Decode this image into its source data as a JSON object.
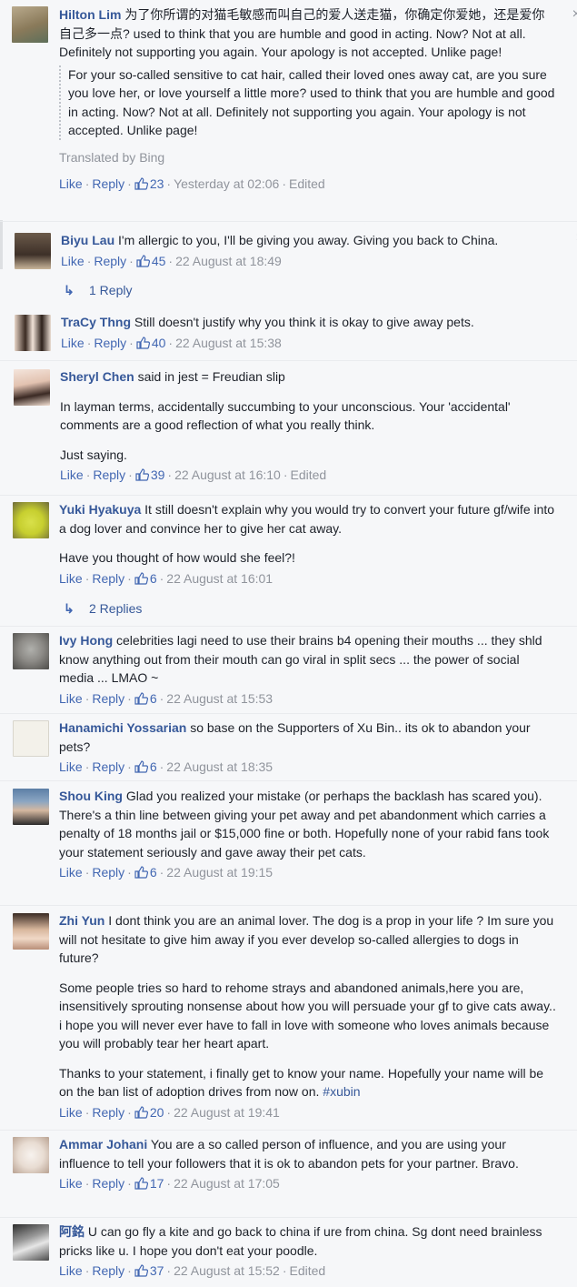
{
  "comments": [
    {
      "author": "Hilton Lim",
      "text": "为了你所谓的对猫毛敏感而叫自己的爱人送走猫，你确定你爱她，还是爱你自己多一点? used to think that you are humble and good in acting. Now? Not at all. Definitely not supporting you again. Your apology is not accepted. Unlike page!",
      "translation": "For your so-called sensitive to cat hair, called their loved ones away cat, are you sure you love her, or love yourself a little more? used to think that you are humble and good in acting. Now? Not at all. Definitely not supporting you again. Your apology is not accepted. Unlike page!",
      "translated_by": "Translated by Bing",
      "like": "Like",
      "reply": "Reply",
      "likes": "23",
      "time": "Yesterday at 02:06",
      "edited": "Edited"
    },
    {
      "author": "Biyu Lau",
      "text": "I'm allergic to you, I'll be giving you away. Giving you back to China.",
      "like": "Like",
      "reply": "Reply",
      "likes": "45",
      "time": "22 August at 18:49",
      "replies": "1 Reply"
    },
    {
      "author": "TraCy Thng",
      "text": "Still doesn't justify why you think it is okay to give away pets.",
      "like": "Like",
      "reply": "Reply",
      "likes": "40",
      "time": "22 August at 15:38"
    },
    {
      "author": "Sheryl Chen",
      "text": "said in jest = Freudian slip",
      "para2": "In layman terms, accidentally succumbing to your unconscious. Your 'accidental' comments are a good reflection of what you really think.",
      "para3": "Just saying.",
      "like": "Like",
      "reply": "Reply",
      "likes": "39",
      "time": "22 August at 16:10",
      "edited": "Edited"
    },
    {
      "author": "Yuki Hyakuya",
      "text": "It still doesn't explain why you would try to convert your future gf/wife into a dog lover and convince her to give her cat away.",
      "para2": "Have you thought of how would she feel?!",
      "like": "Like",
      "reply": "Reply",
      "likes": "6",
      "time": "22 August at 16:01",
      "replies": "2 Replies"
    },
    {
      "author": "Ivy Hong",
      "text": "celebrities lagi need to use their brains b4 opening their mouths ... they shld know anything out from their mouth can go viral in split secs ... the power of social media ... LMAO ~",
      "like": "Like",
      "reply": "Reply",
      "likes": "6",
      "time": "22 August at 15:53"
    },
    {
      "author": "Hanamichi Yossarian",
      "text": "so base on the Supporters of Xu Bin.. its ok to abandon your pets?",
      "like": "Like",
      "reply": "Reply",
      "likes": "6",
      "time": "22 August at 18:35"
    },
    {
      "author": "Shou King",
      "text": "Glad you realized your mistake (or perhaps the backlash has scared you). There's a thin line between giving your pet away and pet abandonment which carries a penalty of 18 months jail or $15,000 fine or both. Hopefully none of your rabid fans took your statement seriously and gave away their pet cats.",
      "like": "Like",
      "reply": "Reply",
      "likes": "6",
      "time": "22 August at 19:15"
    },
    {
      "author": "Zhi Yun",
      "text": "I dont think you are an animal lover. The dog is a prop in your life ? Im sure you will not hesitate to give him away if you ever develop so-called allergies to dogs in future?",
      "para2": "Some people tries so hard to rehome strays and abandoned animals,here you are, insensitively sprouting nonsense about how you will persuade your gf to give cats away.. i hope you will never ever have to fall in love with someone who loves animals because you will probably tear her heart apart.",
      "para3": "Thanks to your statement, i finally get to know your name. Hopefully your name will be on the ban list of adoption drives from now on.",
      "hashtag": "#xubin",
      "like": "Like",
      "reply": "Reply",
      "likes": "20",
      "time": "22 August at 19:41"
    },
    {
      "author": "Ammar Johani",
      "text": "You are a so called person of influence, and you are using your influence to tell your followers that it is ok to abandon pets for your partner. Bravo.",
      "like": "Like",
      "reply": "Reply",
      "likes": "17",
      "time": "22 August at 17:05"
    },
    {
      "author": "阿銘",
      "text": "U can go fly a kite and go back to china if ure from china. Sg dont need brainless pricks like u. I hope you don't eat your poodle.",
      "like": "Like",
      "reply": "Reply",
      "likes": "37",
      "time": "22 August at 15:52",
      "edited": "Edited"
    }
  ],
  "colors": {
    "link": "#365899",
    "meta": "#90949c",
    "background": "#f6f7f9"
  },
  "icons": {
    "close": "close-icon",
    "like": "thumbs-up-icon",
    "reply_arrow": "reply-arrow-icon"
  },
  "glyphs": {
    "close": "×",
    "reply_arrow": "↳",
    "sep": "·"
  }
}
